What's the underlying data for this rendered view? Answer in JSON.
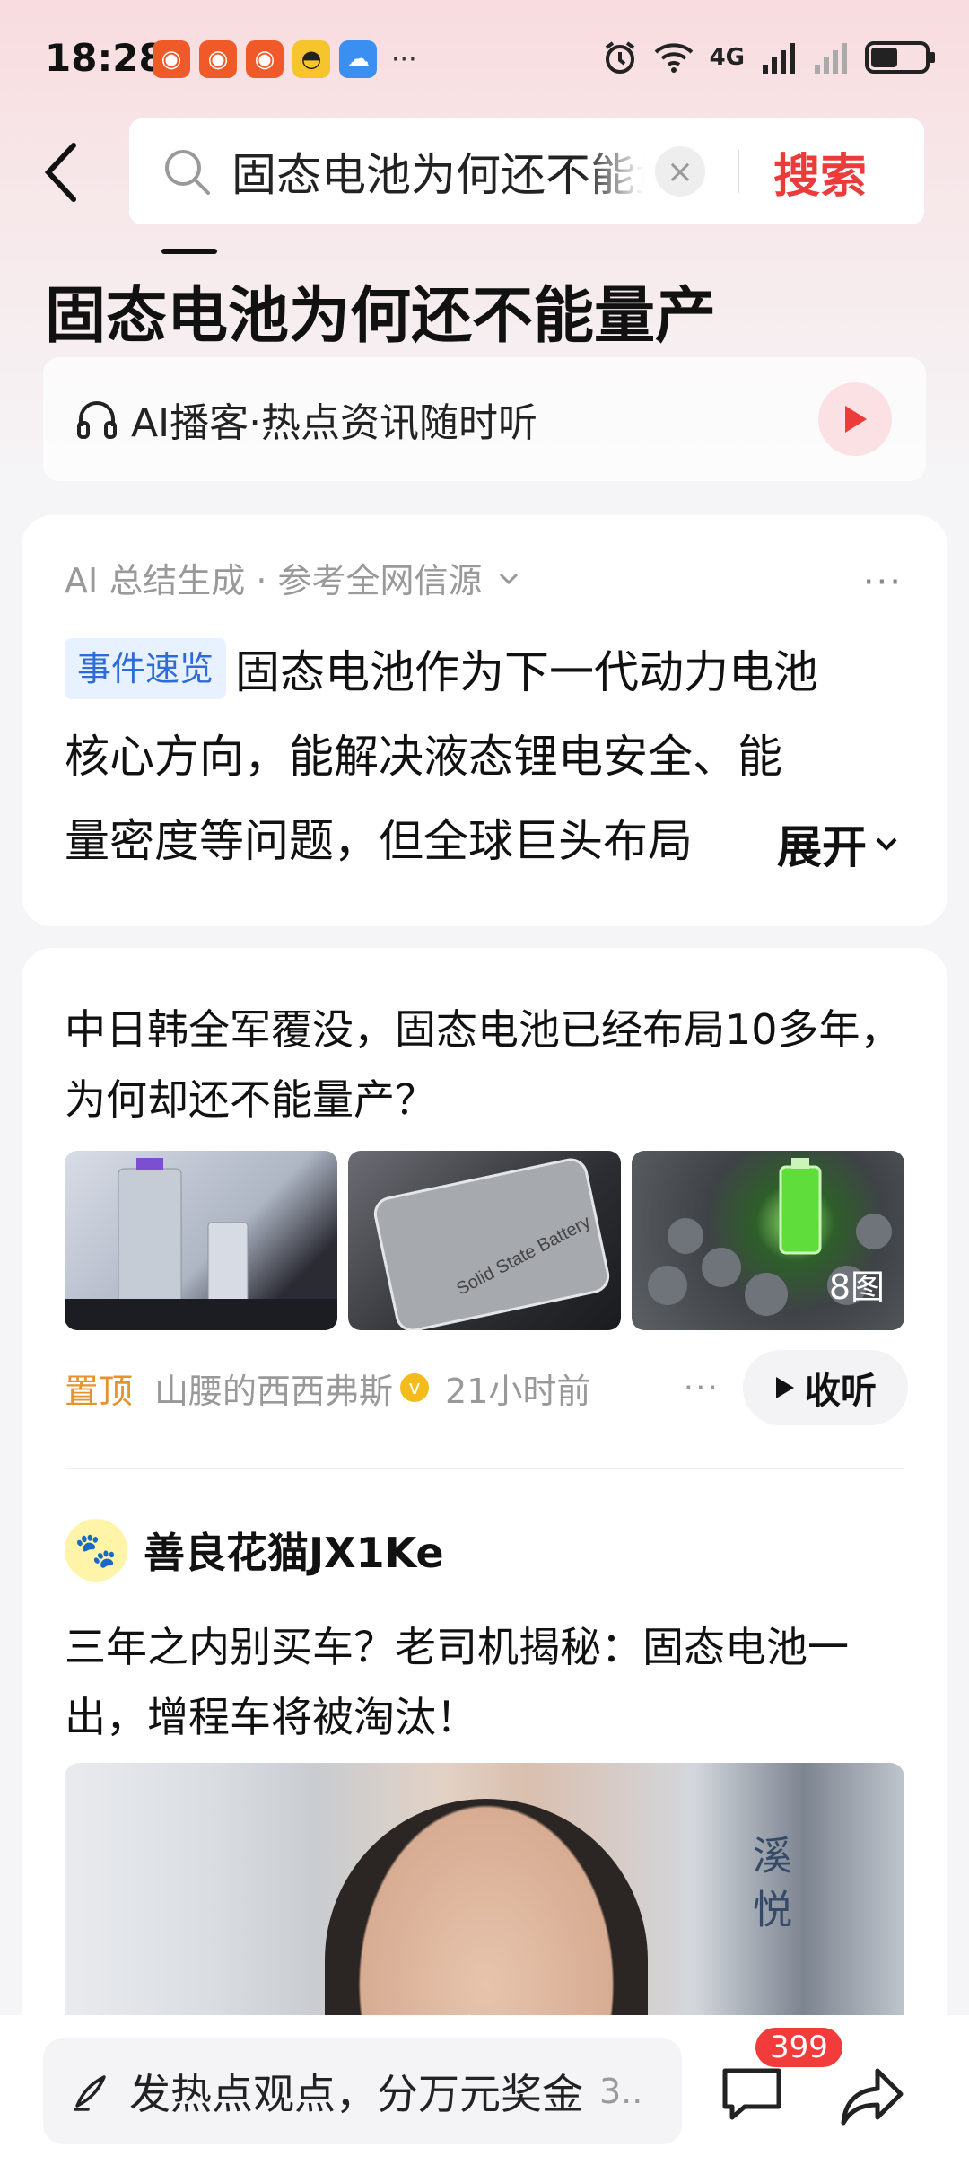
{
  "status_bar": {
    "time": "18:28",
    "more": "···",
    "network": "4G",
    "battery_level": 0.5
  },
  "search": {
    "query": "固态电池为何还不能量产",
    "clear_icon": "×",
    "button_label": "搜索"
  },
  "page_title": "固态电池为何还不能量产",
  "podcast": {
    "label": "AI播客·热点资讯随时听"
  },
  "summary": {
    "meta": "AI 总结生成 · 参考全网信源",
    "more": "···",
    "tag": "事件速览",
    "line1": "固态电池作为下一代动力电池",
    "line2": "核心方向，能解决液态锂电安全、能",
    "line3": "量密度等问题，但全球巨头布局",
    "expand_label": "展开"
  },
  "article": {
    "title": "中日韩全军覆没，固态电池已经布局10多年，为何却还不能量产？",
    "image_count": "8图",
    "pin_label": "置顶",
    "author": "山腰的西西弗斯",
    "time": "21小时前",
    "more": "···",
    "listen_label": "收听",
    "thumb2_text": "Solid State Battery"
  },
  "post": {
    "author": "善良花猫JX1Ke",
    "text": "三年之内别买车？老司机揭秘：固态电池一出，增程车将被淘汰！",
    "video_sign": "溪悦"
  },
  "bottom_bar": {
    "comment_placeholder": "发热点观点，分万元奖金",
    "comment_suffix": "3..",
    "comment_count": "399"
  },
  "colors": {
    "accent_red": "#ec3b3b",
    "tag_blue": "#2c6bd8",
    "pin_orange": "#e6932e"
  }
}
